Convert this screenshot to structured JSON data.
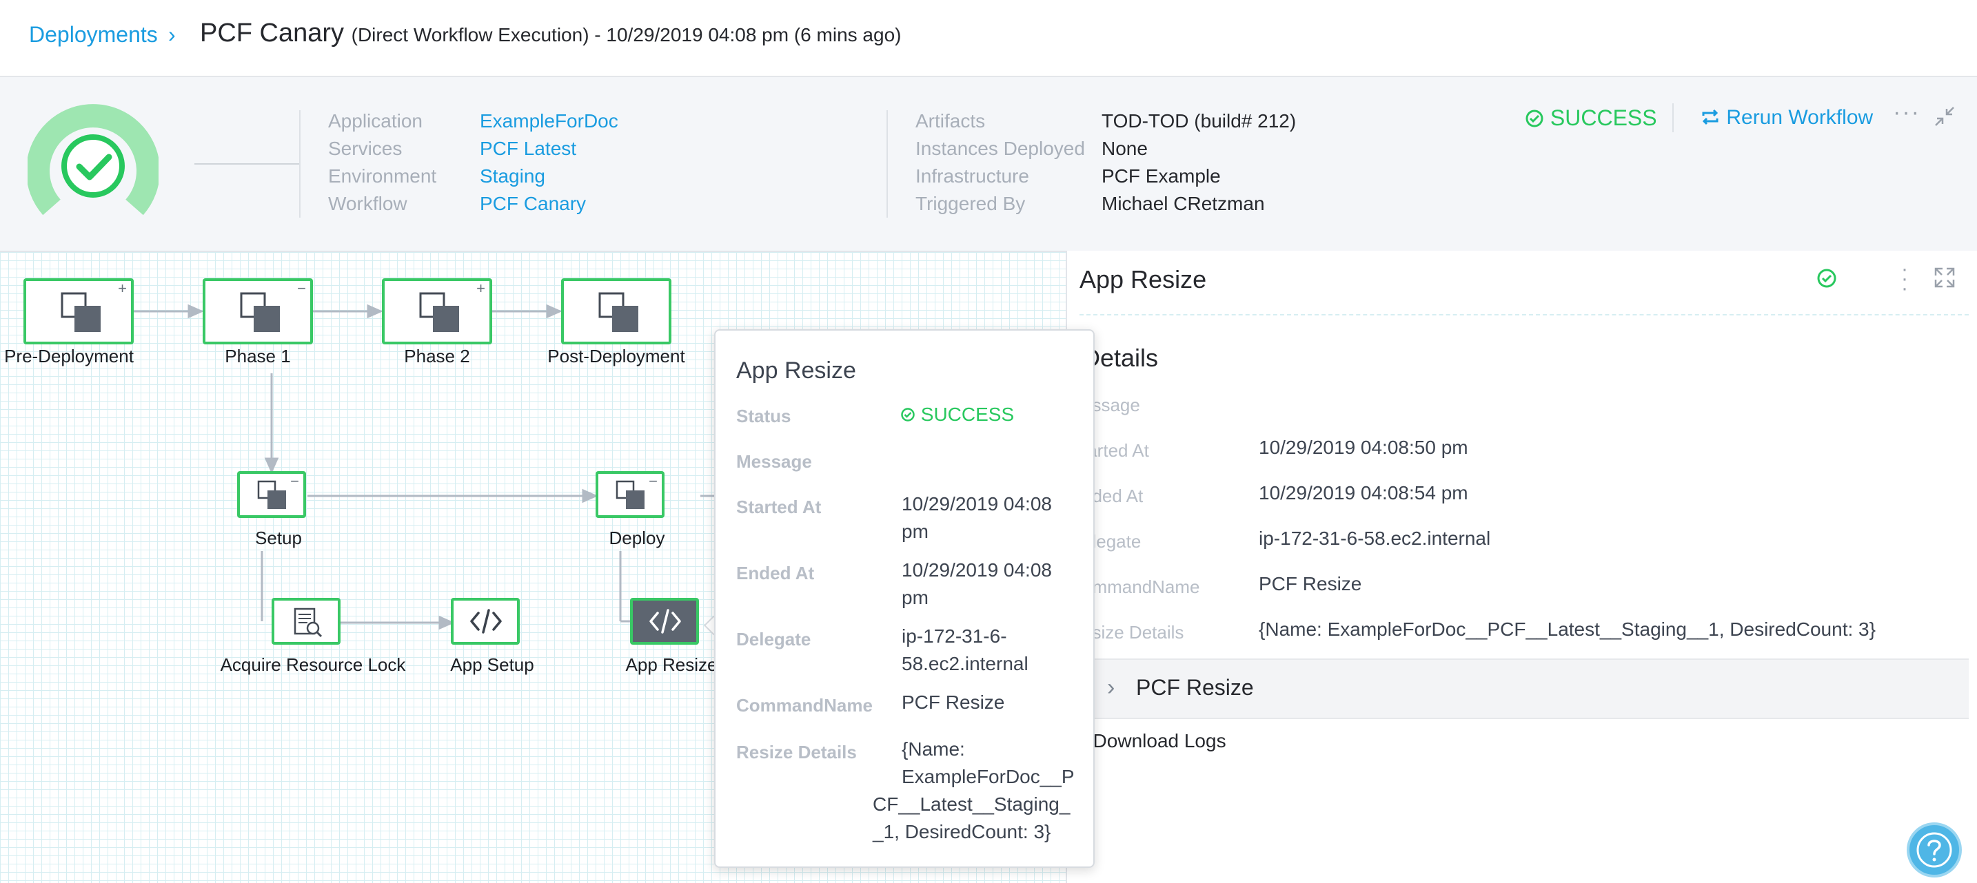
{
  "breadcrumb": {
    "root": "Deployments",
    "title": "PCF Canary",
    "subtitle": "(Direct Workflow Execution) - 10/29/2019 04:08 pm (6 mins ago)"
  },
  "summary": {
    "left": [
      {
        "label": "Application",
        "value": "ExampleForDoc"
      },
      {
        "label": "Services",
        "value": "PCF Latest"
      },
      {
        "label": "Environment",
        "value": "Staging"
      },
      {
        "label": "Workflow",
        "value": "PCF Canary"
      }
    ],
    "right": [
      {
        "label": "Artifacts",
        "value": "TOD-TOD (build# 212)"
      },
      {
        "label": "Instances Deployed",
        "value": "None"
      },
      {
        "label": "Infrastructure",
        "value": "PCF Example"
      },
      {
        "label": "Triggered By",
        "value": "Michael CRetzman"
      }
    ],
    "status": "SUCCESS",
    "rerun_label": "Rerun Workflow",
    "more_icon": "···"
  },
  "workflow": {
    "phases": [
      "Pre-Deployment",
      "Phase 1",
      "Phase 2",
      "Post-Deployment"
    ],
    "steps": {
      "setup": "Setup",
      "deploy": "Deploy",
      "acquire_lock": "Acquire Resource Lock",
      "app_setup": "App Setup",
      "app_resize": "App Resize"
    }
  },
  "tooltip": {
    "title": "App Resize",
    "status_label": "Status",
    "status_value": "SUCCESS",
    "message_label": "Message",
    "started_label": "Started At",
    "started_value_1": "10/29/2019 04:08",
    "started_value_2": "pm",
    "ended_label": "Ended At",
    "ended_value_1": "10/29/2019 04:08",
    "ended_value_2": "pm",
    "delegate_label": "Delegate",
    "delegate_value_1": "ip-172-31-6-",
    "delegate_value_2": "58.ec2.internal",
    "command_label": "CommandName",
    "command_value": "PCF Resize",
    "resize_label": "Resize Details",
    "resize_value_1": "{Name:",
    "resize_value_2": "ExampleForDoc__P",
    "resize_value_3": "CF__Latest__Staging_",
    "resize_value_4": "_1, DesiredCount: 3}"
  },
  "panel": {
    "title": "App Resize",
    "details_heading": "Details",
    "rows": [
      {
        "label": "essage",
        "value": ""
      },
      {
        "label": "tarted At",
        "value": "10/29/2019 04:08:50 pm"
      },
      {
        "label": "nded At",
        "value": "10/29/2019 04:08:54 pm"
      },
      {
        "label": "elegate",
        "value": "ip-172-31-6-58.ec2.internal"
      },
      {
        "label": "ommandName",
        "value": "PCF Resize"
      },
      {
        "label": "esize Details",
        "value": "{Name: ExampleForDoc__PCF__Latest__Staging__1, DesiredCount: 3}"
      }
    ],
    "section_label": "PCF Resize",
    "download_logs": ". Download Logs"
  },
  "colors": {
    "accent": "#1a9ce0",
    "success": "#28c85e",
    "node_border": "#39c865"
  },
  "icons": [
    "success-gauge-icon",
    "check-circle-icon",
    "rerun-icon",
    "more-icon",
    "collapse-icon",
    "expand-icon",
    "phase-icon",
    "log-icon",
    "code-icon",
    "chevron-right-icon",
    "help-icon"
  ]
}
